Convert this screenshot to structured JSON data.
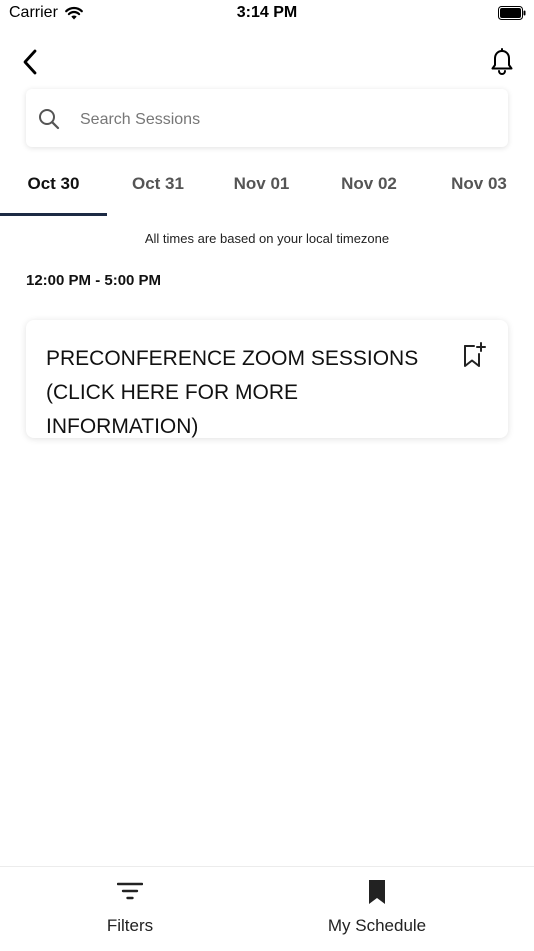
{
  "status_bar": {
    "carrier": "Carrier",
    "time": "3:14 PM"
  },
  "search": {
    "placeholder": "Search Sessions",
    "value": ""
  },
  "date_tabs": [
    {
      "label": "Oct 30",
      "active": true
    },
    {
      "label": "Oct 31",
      "active": false
    },
    {
      "label": "Nov 01",
      "active": false
    },
    {
      "label": "Nov 02",
      "active": false
    },
    {
      "label": "Nov 03",
      "active": false
    }
  ],
  "timezone_note": "All times are based on your local timezone",
  "schedule": {
    "time_range": "12:00 PM - 5:00 PM",
    "sessions": [
      {
        "title": "PRECONFERENCE ZOOM SESSIONS (CLICK HERE FOR MORE INFORMATION)"
      }
    ]
  },
  "bottom_bar": {
    "filters_label": "Filters",
    "my_schedule_label": "My Schedule"
  },
  "colors": {
    "accent": "#1c2a44",
    "text": "#111111",
    "muted": "#777777"
  },
  "icons": {
    "back": "chevron-left-icon",
    "notifications": "bell-icon",
    "search": "search-icon",
    "bookmark_add": "bookmark-plus-icon",
    "filters": "filter-icon",
    "my_schedule": "bookmark-icon"
  }
}
